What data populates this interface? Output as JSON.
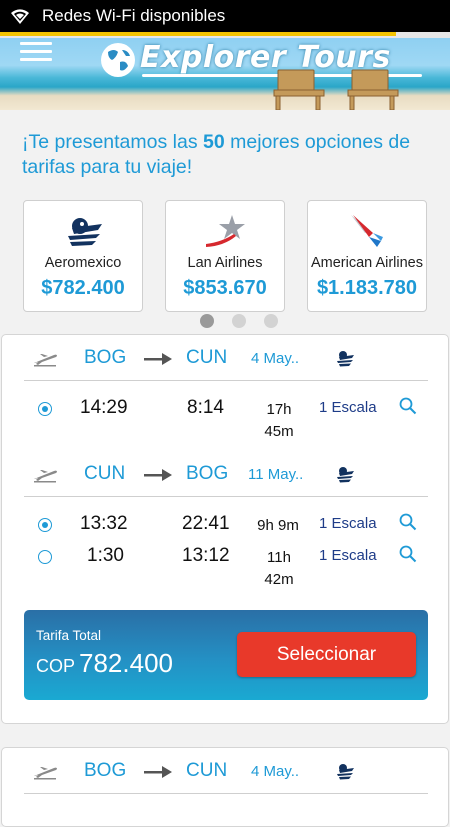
{
  "status_bar": {
    "text": "Redes Wi-Fi disponibles"
  },
  "loading": {
    "progress": 0.88
  },
  "header": {
    "logo_text": "Explorer Tours"
  },
  "intro": {
    "prefix": "¡Te presentamos las ",
    "count": "50",
    "suffix": " mejores opciones de tarifas para tu viaje!"
  },
  "airlines": [
    {
      "name": "Aeromexico",
      "price": "$782.400",
      "logo": "aeromexico-eagle-icon"
    },
    {
      "name": "Lan Airlines",
      "price": "$853.670",
      "logo": "lan-star-icon"
    },
    {
      "name": "American Airlines",
      "price": "$1.183.780",
      "logo": "american-airlines-eagle-icon"
    }
  ],
  "carousel": {
    "pages": 3,
    "active": 0
  },
  "flights": [
    {
      "outbound": {
        "from": "BOG",
        "to": "CUN",
        "date": "4 May..",
        "options": [
          {
            "selected": true,
            "depart": "14:29",
            "arrive": "8:14",
            "duration": "17h 45m",
            "stops": "1 Escala"
          }
        ]
      },
      "return": {
        "from": "CUN",
        "to": "BOG",
        "date": "11 May..",
        "options": [
          {
            "selected": true,
            "depart": "13:32",
            "arrive": "22:41",
            "duration": "9h 9m",
            "stops": "1 Escala"
          },
          {
            "selected": false,
            "depart": "1:30",
            "arrive": "13:12",
            "duration": "11h 42m",
            "stops": "1 Escala"
          }
        ]
      },
      "total": {
        "label": "Tarifa Total",
        "currency": "COP",
        "amount": "782.400"
      },
      "select_label": "Seleccionar"
    },
    {
      "outbound": {
        "from": "BOG",
        "to": "CUN",
        "date": "4 May.."
      }
    }
  ],
  "colors": {
    "accent": "#1e9ad6",
    "select_button": "#e8392a",
    "stops_text": "#1e3c88"
  }
}
